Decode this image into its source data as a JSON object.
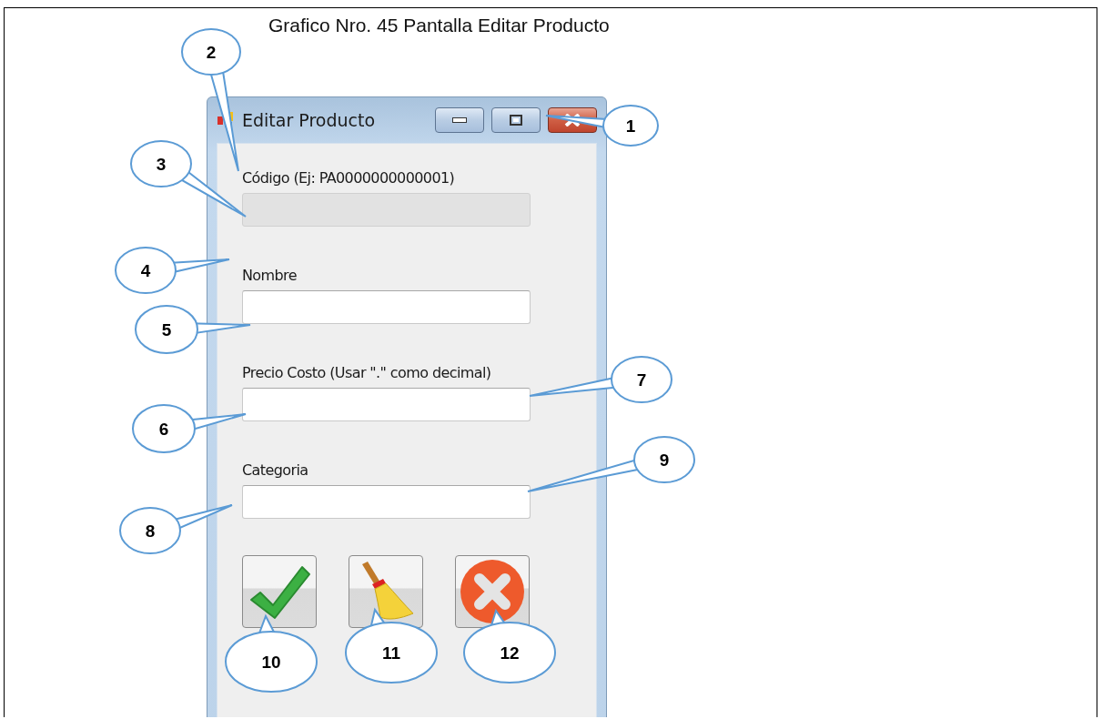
{
  "caption": "Grafico Nro. 45 Pantalla Editar Producto",
  "window": {
    "title": "Editar Producto"
  },
  "fields": [
    {
      "label": "Código (Ej: PA0000000000001)",
      "disabled": true
    },
    {
      "label": "Nombre",
      "disabled": false
    },
    {
      "label": "Precio Costo (Usar \".\" como decimal)",
      "disabled": false
    },
    {
      "label": "Categoria",
      "disabled": false
    }
  ],
  "buttons": [
    {
      "kind": "accept"
    },
    {
      "kind": "clear"
    },
    {
      "kind": "cancel"
    }
  ],
  "callouts": [
    {
      "number": "1"
    },
    {
      "number": "2"
    },
    {
      "number": "3"
    },
    {
      "number": "4"
    },
    {
      "number": "5"
    },
    {
      "number": "6"
    },
    {
      "number": "7"
    },
    {
      "number": "8"
    },
    {
      "number": "9"
    },
    {
      "number": "10"
    },
    {
      "number": "11"
    },
    {
      "number": "12"
    }
  ]
}
